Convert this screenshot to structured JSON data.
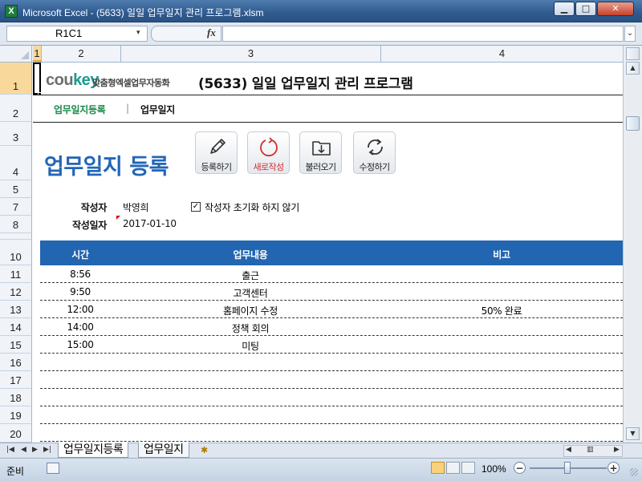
{
  "window": {
    "app_letter": "X",
    "title": "Microsoft Excel - (5633) 일일 업무일지 관리 프로그램.xlsm",
    "min_glyph": "▁",
    "max_glyph": "□",
    "close_glyph": "✕"
  },
  "formula_bar": {
    "name_box": "R1C1",
    "dropdown_glyph": "▾",
    "fx": "fx",
    "expand_glyph": "⌄",
    "value": ""
  },
  "columns": [
    {
      "label": "1"
    },
    {
      "label": "2"
    },
    {
      "label": "3"
    },
    {
      "label": "4"
    }
  ],
  "rows": [
    "1",
    "2",
    "3",
    "4",
    "5",
    "7",
    "8",
    "10",
    "11",
    "12",
    "13",
    "14",
    "15",
    "16",
    "17",
    "18",
    "19",
    "20"
  ],
  "header": {
    "logo_cou": "cou",
    "logo_key": "key",
    "logo_sub": "맞춤형엑셀업무자동화",
    "title": "(5633) 일일 업무일지 관리 프로그램"
  },
  "nav": {
    "active": "업무일지등록",
    "separator": "|",
    "item": "업무일지"
  },
  "page_title": "업무일지 등록",
  "toolbar": {
    "register": "등록하기",
    "new": "새로작성",
    "load": "불러오기",
    "edit": "수정하기"
  },
  "form": {
    "author_label": "작성자",
    "author_value": "박영희",
    "date_label": "작성일자",
    "date_value": "2017-01-10",
    "checkbox_checked": true,
    "checkbox_glyph": "✓",
    "checkbox_label": "작성자 초기화 하지 않기"
  },
  "table": {
    "headers": [
      "시간",
      "업무내용",
      "비고"
    ],
    "rows": [
      [
        "8:56",
        "출근",
        ""
      ],
      [
        "9:50",
        "고객센터",
        ""
      ],
      [
        "12:00",
        "홈페이지 수정",
        "50% 완료"
      ],
      [
        "14:00",
        "정책 회의",
        ""
      ],
      [
        "15:00",
        "미팅",
        ""
      ],
      [
        "",
        "",
        ""
      ],
      [
        "",
        "",
        ""
      ],
      [
        "",
        "",
        ""
      ],
      [
        "",
        "",
        ""
      ],
      [
        "",
        "",
        ""
      ]
    ]
  },
  "sheet_tabs": {
    "nav_glyphs": [
      "|◀",
      "◀",
      "▶",
      "▶|"
    ],
    "tabs": [
      "업무일지등록",
      "업무일지"
    ],
    "new_tab_glyph": "✱"
  },
  "status": {
    "ready": "준비",
    "zoom": "100%",
    "zoom_out": "−",
    "zoom_in": "+"
  },
  "colors": {
    "accent_blue": "#2265b0",
    "nav_green": "#1b8a4a",
    "button_red": "#d03030"
  }
}
